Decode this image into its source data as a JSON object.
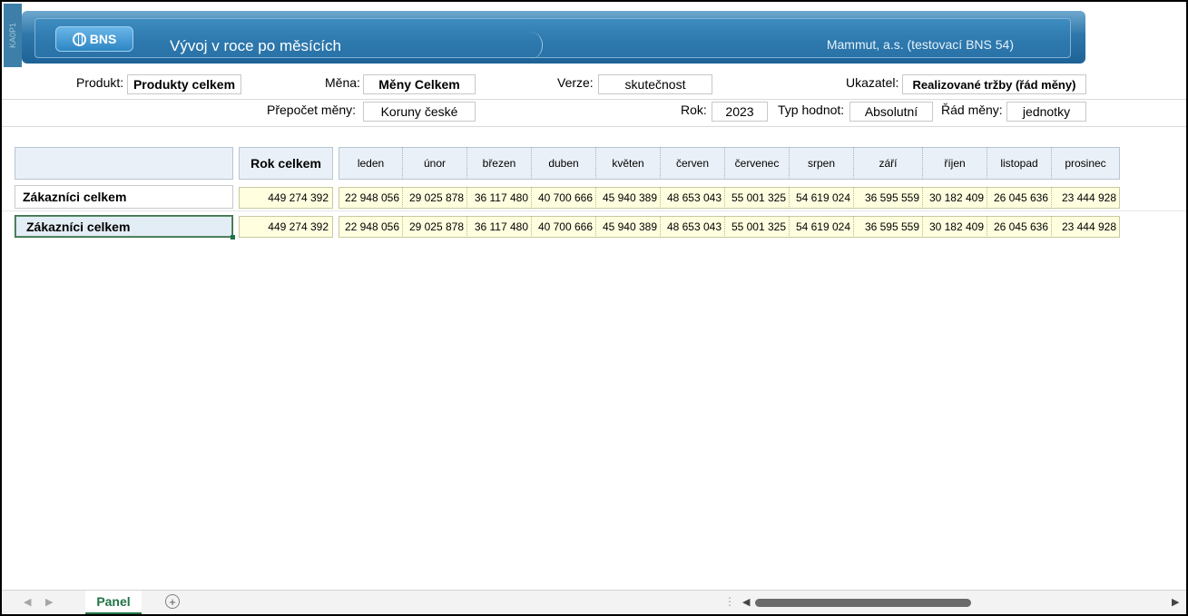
{
  "side_label": "KA0P1",
  "banner": {
    "logo_text": "BNS",
    "title": "Vývoj v roce po měsících",
    "company": "Mammut, a.s. (testovací BNS 54)"
  },
  "params": {
    "produkt": {
      "label": "Produkt:",
      "value": "Produkty celkem"
    },
    "mena": {
      "label": "Měna:",
      "value": "Měny Celkem"
    },
    "verze": {
      "label": "Verze:",
      "value": "skutečnost"
    },
    "ukazatel": {
      "label": "Ukazatel:",
      "value": "Realizované tržby (řád měny)"
    },
    "prepocet": {
      "label": "Přepočet měny:",
      "value": "Koruny české"
    },
    "rok": {
      "label": "Rok:",
      "value": "2023"
    },
    "typ": {
      "label": "Typ hodnot:",
      "value": "Absolutní"
    },
    "rad": {
      "label": "Řád měny:",
      "value": "jednotky"
    }
  },
  "table": {
    "total_header": "Rok celkem",
    "months": [
      "leden",
      "únor",
      "březen",
      "duben",
      "květen",
      "červen",
      "červenec",
      "srpen",
      "září",
      "říjen",
      "listopad",
      "prosinec"
    ],
    "rows": [
      {
        "label": "Zákazníci celkem",
        "total": "449 274 392",
        "values": [
          "22 948 056",
          "29 025 878",
          "36 117 480",
          "40 700 666",
          "45 940 389",
          "48 653 043",
          "55 001 325",
          "54 619 024",
          "36 595 559",
          "30 182 409",
          "26 045 636",
          "23 444 928"
        ]
      },
      {
        "label": "Zákazníci celkem",
        "total": "449 274 392",
        "values": [
          "22 948 056",
          "29 025 878",
          "36 117 480",
          "40 700 666",
          "45 940 389",
          "48 653 043",
          "55 001 325",
          "54 619 024",
          "36 595 559",
          "30 182 409",
          "26 045 636",
          "23 444 928"
        ]
      }
    ]
  },
  "sheets": {
    "active": "Panel",
    "add_symbol": "+"
  },
  "nav": {
    "prev": "◀",
    "next": "▶",
    "dots": "⋮"
  }
}
